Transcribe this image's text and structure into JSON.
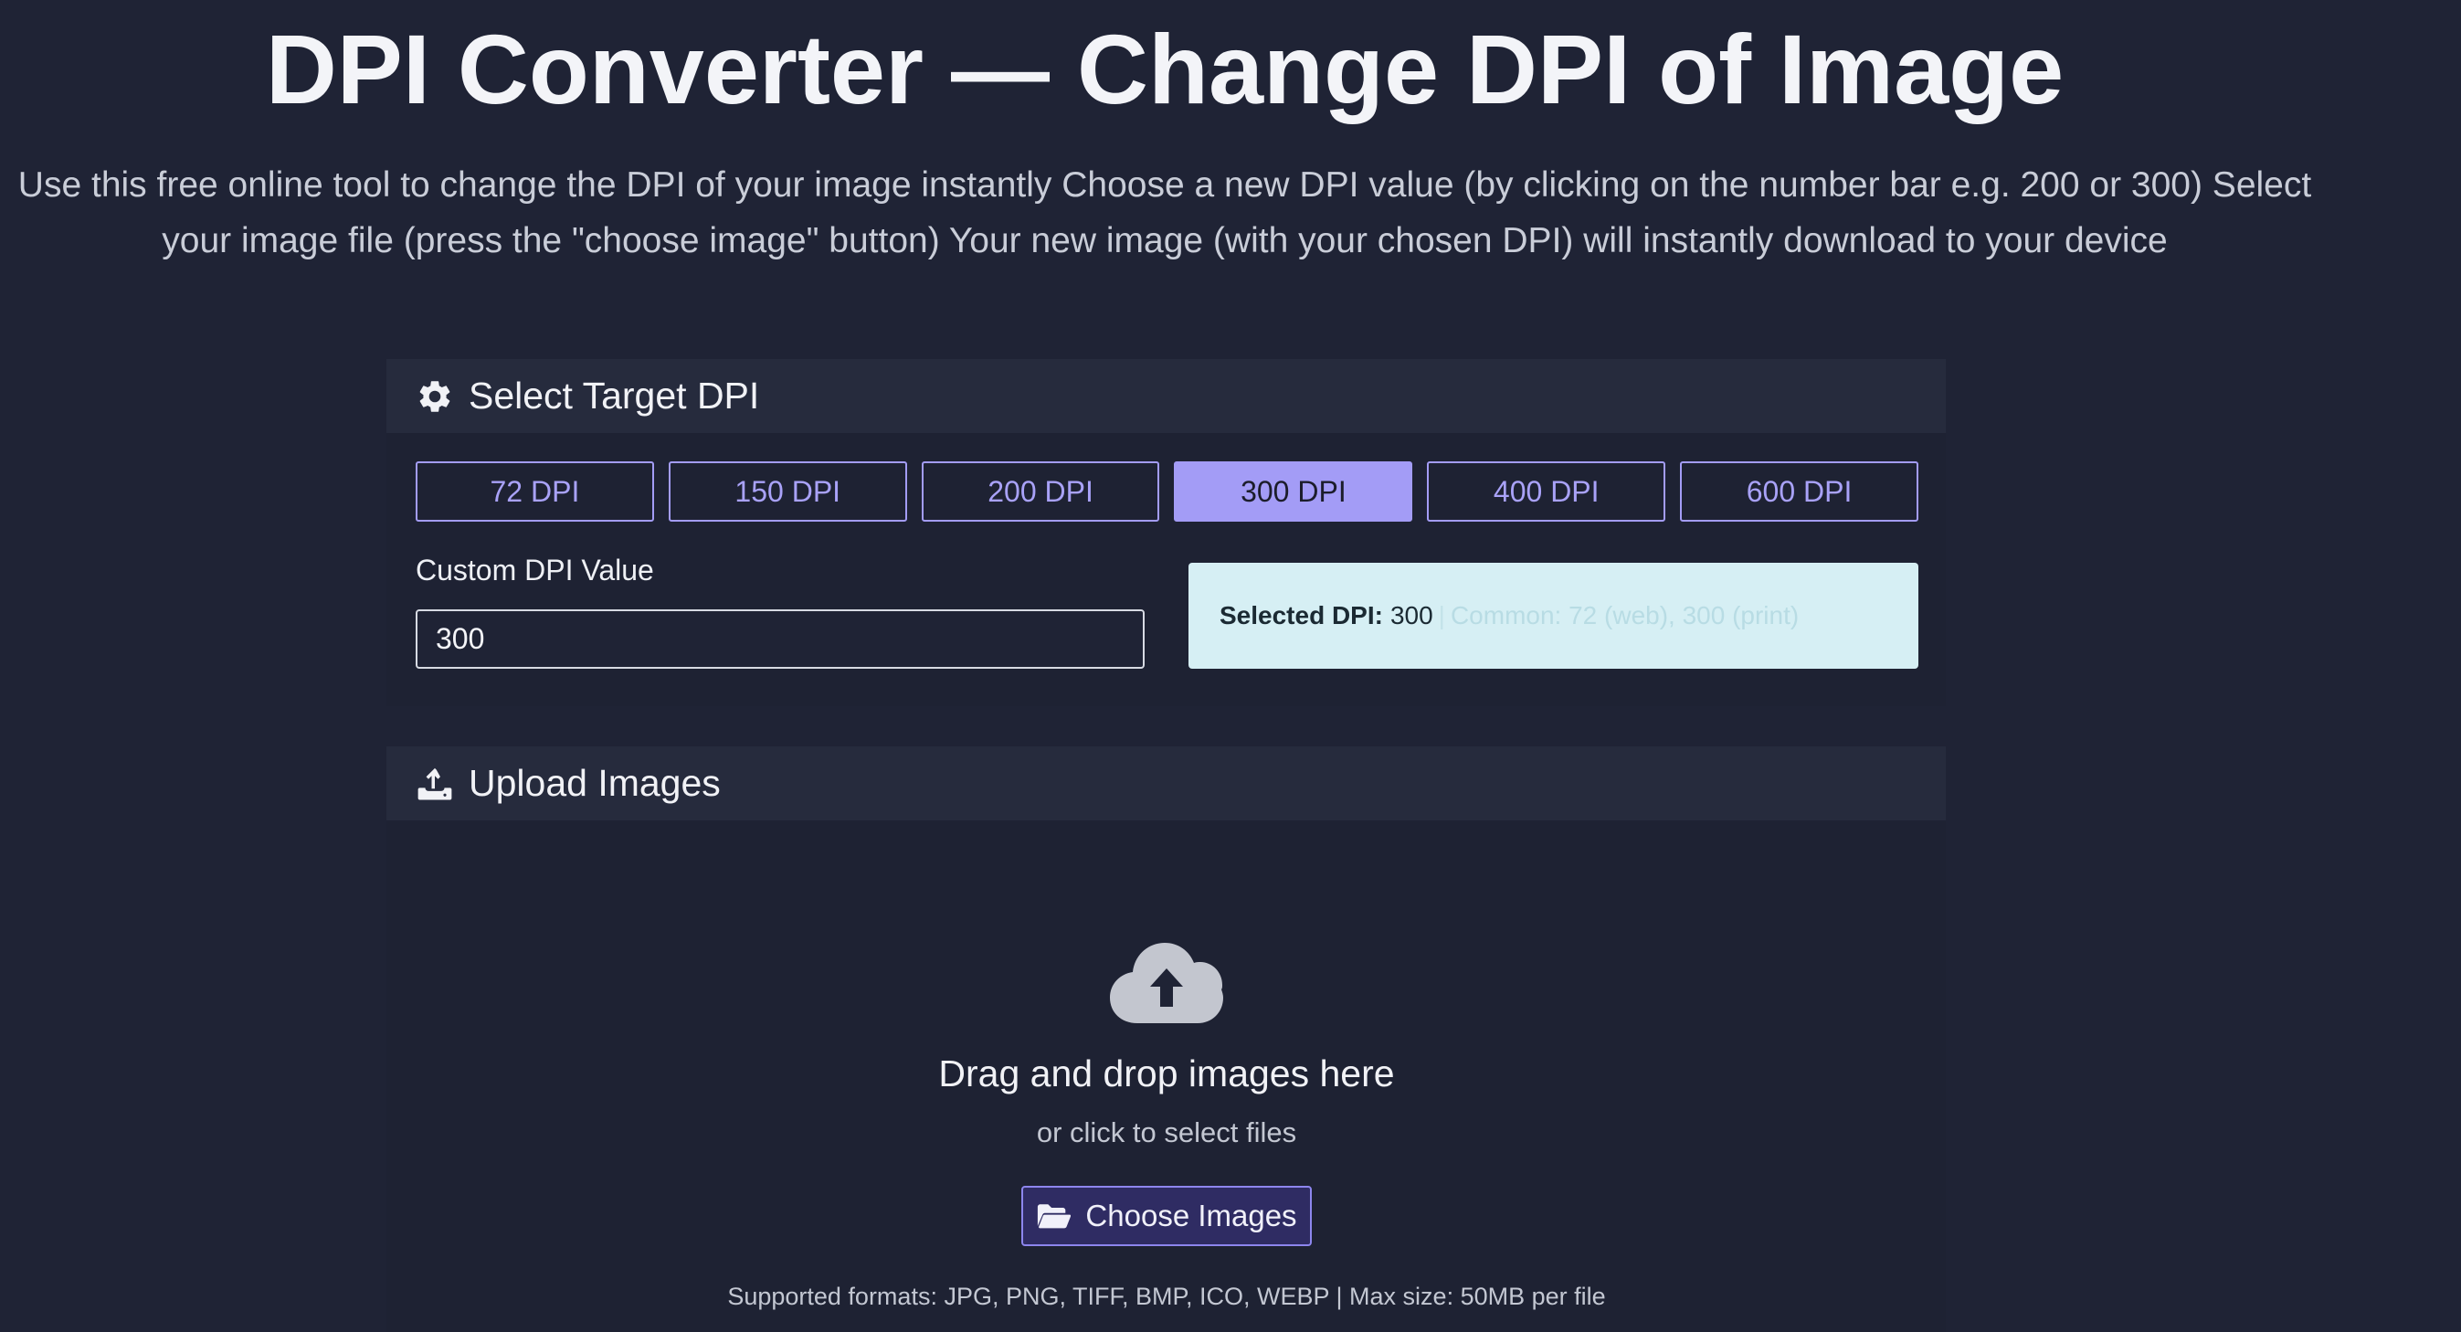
{
  "header": {
    "title": "DPI Converter — Change DPI of Image",
    "intro": "Use this free online tool to change the DPI of your image instantly Choose a new DPI value (by clicking on the number bar e.g. 200 or 300) Select your image file (press the \"choose image\" button) Your new image (with your chosen DPI) will instantly download to your device"
  },
  "dpi_section": {
    "title": "Select Target DPI",
    "icon": "gear-icon",
    "options": [
      {
        "label": "72 DPI",
        "active": false
      },
      {
        "label": "150 DPI",
        "active": false
      },
      {
        "label": "200 DPI",
        "active": false
      },
      {
        "label": "300 DPI",
        "active": true
      },
      {
        "label": "400 DPI",
        "active": false
      },
      {
        "label": "600 DPI",
        "active": false
      }
    ],
    "custom_label": "Custom DPI Value",
    "custom_value": "300",
    "info": {
      "selected_label": "Selected DPI:",
      "selected_value": "300",
      "separator": "|",
      "common_text": "Common: 72 (web), 300 (print)"
    }
  },
  "upload_section": {
    "title": "Upload Images",
    "icon": "upload-icon",
    "drop_icon": "cloud-upload-icon",
    "drop_title": "Drag and drop images here",
    "drop_subtitle": "or click to select files",
    "button_label": "Choose Images",
    "button_icon": "folder-open-icon",
    "formats_text": "Supported formats: JPG, PNG, TIFF, BMP, ICO, WEBP | Max size: 50MB per file"
  },
  "colors": {
    "background": "#1f2335",
    "card_header": "#262b3d",
    "accent": "#a39cf6",
    "info_box": "#d6eff4"
  }
}
